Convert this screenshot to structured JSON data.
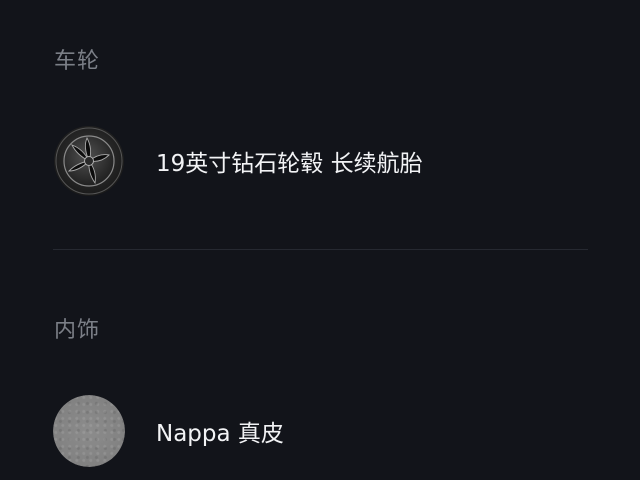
{
  "sections": {
    "wheels": {
      "title": "车轮",
      "option": {
        "label": "19英寸钻石轮毂 长续航胎",
        "thumbnail_icon": "wheel-icon"
      }
    },
    "interior": {
      "title": "内饰",
      "option": {
        "label": "Nappa 真皮",
        "thumbnail_icon": "leather-swatch-icon",
        "swatch_color": "#858585"
      }
    }
  },
  "colors": {
    "background": "#12141a",
    "section_title": "#7b7f87",
    "option_text": "#f2f3f5",
    "divider": "#262931"
  }
}
